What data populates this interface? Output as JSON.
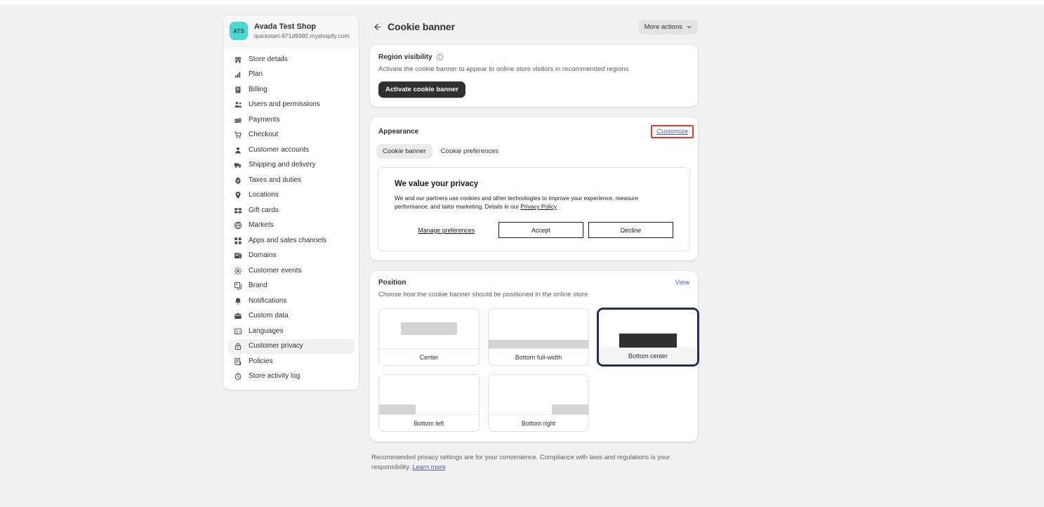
{
  "sidebar": {
    "shop": {
      "initials": "ATS",
      "name": "Avada Test Shop",
      "domain": "quickstart-971d9392.myshopify.com"
    },
    "items": [
      {
        "label": "Store details",
        "icon": "store-icon",
        "active": false
      },
      {
        "label": "Plan",
        "icon": "plan-icon",
        "active": false
      },
      {
        "label": "Billing",
        "icon": "billing-icon",
        "active": false
      },
      {
        "label": "Users and permissions",
        "icon": "users-icon",
        "active": false
      },
      {
        "label": "Payments",
        "icon": "payments-icon",
        "active": false
      },
      {
        "label": "Checkout",
        "icon": "cart-icon",
        "active": false
      },
      {
        "label": "Customer accounts",
        "icon": "person-icon",
        "active": false
      },
      {
        "label": "Shipping and delivery",
        "icon": "truck-icon",
        "active": false
      },
      {
        "label": "Taxes and duties",
        "icon": "tax-icon",
        "active": false
      },
      {
        "label": "Locations",
        "icon": "pin-icon",
        "active": false
      },
      {
        "label": "Gift cards",
        "icon": "giftcard-icon",
        "active": false
      },
      {
        "label": "Markets",
        "icon": "globe-icon",
        "active": false
      },
      {
        "label": "Apps and sales channels",
        "icon": "apps-icon",
        "active": false
      },
      {
        "label": "Domains",
        "icon": "domains-icon",
        "active": false
      },
      {
        "label": "Customer events",
        "icon": "events-icon",
        "active": false
      },
      {
        "label": "Brand",
        "icon": "brand-icon",
        "active": false
      },
      {
        "label": "Notifications",
        "icon": "bell-icon",
        "active": false
      },
      {
        "label": "Custom data",
        "icon": "database-icon",
        "active": false
      },
      {
        "label": "Languages",
        "icon": "languages-icon",
        "active": false
      },
      {
        "label": "Customer privacy",
        "icon": "lock-icon",
        "active": true
      },
      {
        "label": "Policies",
        "icon": "policies-icon",
        "active": false
      },
      {
        "label": "Store activity log",
        "icon": "activity-icon",
        "active": false
      }
    ]
  },
  "header": {
    "back_icon": "arrow-left-icon",
    "title": "Cookie banner",
    "more_actions_label": "More actions",
    "more_actions_icon": "chevron-down-icon"
  },
  "region_visibility": {
    "title": "Region visibility",
    "info_icon": "info-circle-icon",
    "description": "Activate the cookie banner to appear to online store visitors in recommended regions",
    "activate_label": "Activate cookie banner"
  },
  "appearance": {
    "title": "Appearance",
    "customize_label": "Customize",
    "highlight_color": "#e8392c",
    "link_color": "#4f5bd5",
    "tabs": [
      {
        "label": "Cookie banner",
        "active": true
      },
      {
        "label": "Cookie preferences",
        "active": false
      }
    ],
    "banner_preview": {
      "title": "We value your privacy",
      "body_part1": "We and our partners use cookies and other technologies to improve your experience, measure performance, and tailor marketing. Details in our ",
      "policy_link": "Privacy Policy",
      "manage_label": "Manage preferences",
      "accept_label": "Accept",
      "decline_label": "Decline"
    }
  },
  "position": {
    "title": "Position",
    "view_label": "View",
    "description": "Choose how the cookie banner should be positioned in the online store",
    "options": [
      {
        "label": "Center",
        "variant": "t-center",
        "selected": false
      },
      {
        "label": "Bottom full-width",
        "variant": "t-bfw",
        "selected": false
      },
      {
        "label": "Bottom center",
        "variant": "t-bc",
        "selected": true
      },
      {
        "label": "Bottom left",
        "variant": "t-bl",
        "selected": false
      },
      {
        "label": "Bottom right",
        "variant": "t-br",
        "selected": false
      }
    ]
  },
  "footer": {
    "text": "Recommended privacy settings are for your convenience. Compliance with laws and regulations is your responsibility. ",
    "link_label": "Learn more"
  }
}
